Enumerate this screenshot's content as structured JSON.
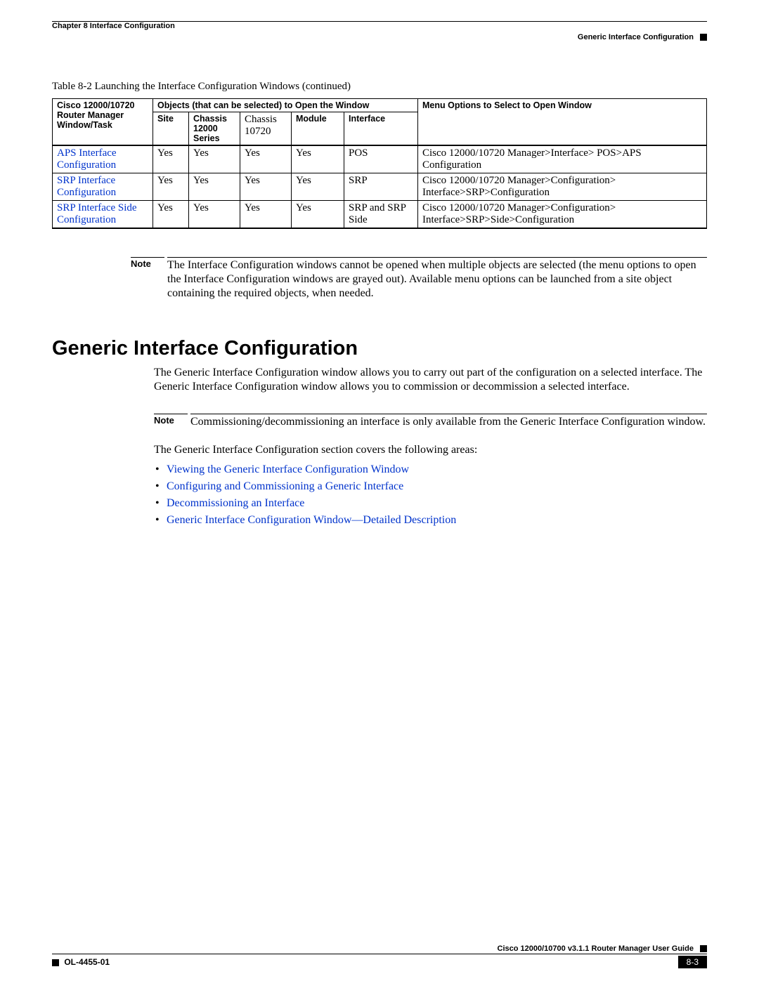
{
  "header": {
    "chapter": "Chapter 8      Interface Configuration",
    "sub": "Generic Interface Configuration"
  },
  "caption": "Table 8-2    Launching the Interface Configuration Windows (continued)",
  "table": {
    "head": {
      "col0": "Cisco 12000/10720 Router Manager Window/Task",
      "group": "Objects (that can be selected) to Open the Window",
      "menu": "Menu Options to Select to Open Window",
      "site": "Site",
      "c12": "Chassis 12000 Series",
      "c107": "Chassis 10720",
      "mod": "Module",
      "intf": "Interface"
    },
    "rows": [
      {
        "task": "APS Interface Configuration",
        "site": "Yes",
        "c12": "Yes",
        "c107": "Yes",
        "mod": "Yes",
        "intf": "POS",
        "menu": "Cisco 12000/10720 Manager>Interface> POS>APS Configuration"
      },
      {
        "task": "SRP Interface Configuration",
        "site": "Yes",
        "c12": "Yes",
        "c107": "Yes",
        "mod": "Yes",
        "intf": "SRP",
        "menu": "Cisco 12000/10720 Manager>Configuration> Interface>SRP>Configuration"
      },
      {
        "task": "SRP Interface Side Configuration",
        "site": "Yes",
        "c12": "Yes",
        "c107": "Yes",
        "mod": "Yes",
        "intf": "SRP and SRP Side",
        "menu": "Cisco 12000/10720 Manager>Configuration> Interface>SRP>Side>Configuration"
      }
    ]
  },
  "note1": {
    "label": "Note",
    "text": "The Interface Configuration windows cannot be opened when multiple objects are selected (the menu options to open the Interface Configuration windows are grayed out). Available menu options can be launched from a site object containing the required objects, when needed."
  },
  "section_title": "Generic Interface Configuration",
  "para1": "The Generic Interface Configuration window allows you to carry out part of the configuration on a selected interface. The Generic Interface Configuration window allows you to commission or decommission a selected interface.",
  "note2": {
    "label": "Note",
    "text": "Commissioning/decommissioning an interface is only available from the Generic Interface Configuration window."
  },
  "para2": "The Generic Interface Configuration section covers the following areas:",
  "links": [
    "Viewing the Generic Interface Configuration Window",
    "Configuring and Commissioning a Generic Interface",
    "Decommissioning an Interface",
    "Generic Interface Configuration Window—Detailed Description"
  ],
  "footer": {
    "guide": "Cisco 12000/10700 v3.1.1 Router Manager User Guide",
    "docid": "OL-4455-01",
    "page": "8-3"
  }
}
